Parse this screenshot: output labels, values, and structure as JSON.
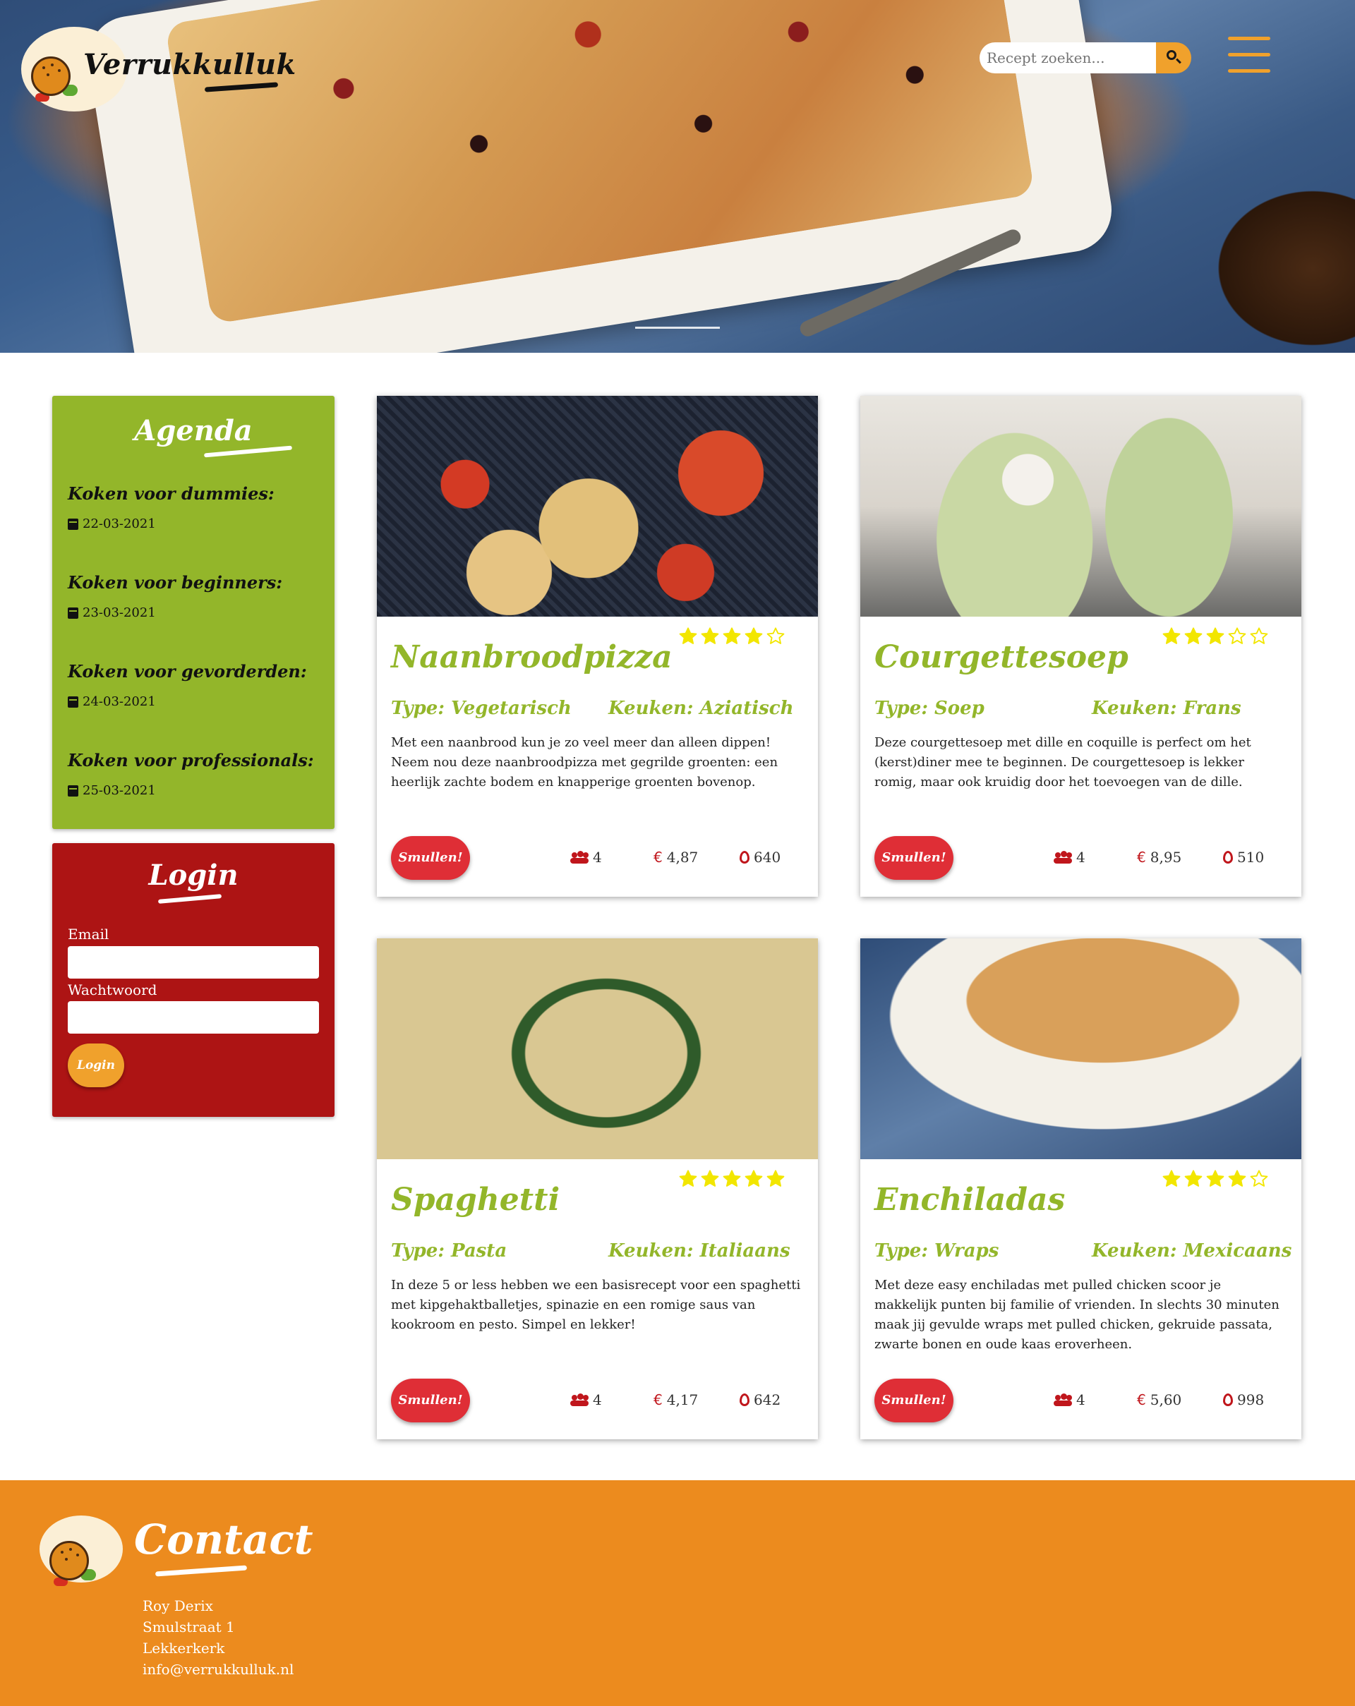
{
  "header": {
    "brand": "Verrukkulluk",
    "search_placeholder": "Recept zoeken..."
  },
  "agenda": {
    "title": "Agenda",
    "events": [
      {
        "name": "Koken voor dummies:",
        "date": "22-03-2021"
      },
      {
        "name": "Koken voor beginners:",
        "date": "23-03-2021"
      },
      {
        "name": "Koken voor gevorderden:",
        "date": "24-03-2021"
      },
      {
        "name": "Koken voor professionals:",
        "date": "25-03-2021"
      }
    ]
  },
  "login": {
    "title": "Login",
    "email_label": "Email",
    "password_label": "Wachtwoord",
    "button_label": "Login"
  },
  "recipes": [
    {
      "title": "Naanbroodpizza",
      "rating": 4,
      "type": "Type: Vegetarisch",
      "cuisine": "Keuken: Aziatisch",
      "description": "Met een naanbrood kun je zo veel meer dan alleen dippen! Neem nou deze naanbroodpizza met gegrilde groenten: een heerlijk zachte bodem en knapperige groenten bovenop.",
      "button": "Smullen!",
      "people": "4",
      "price": "4,87",
      "calories": "640"
    },
    {
      "title": "Courgettesoep",
      "rating": 3,
      "type": "Type: Soep",
      "cuisine": "Keuken: Frans",
      "description": "Deze courgettesoep met dille en coquille is perfect om het (kerst)diner mee te beginnen. De courgettesoep is lekker romig, maar ook kruidig door het toevoegen van de dille.",
      "button": "Smullen!",
      "people": "4",
      "price": "8,95",
      "calories": "510"
    },
    {
      "title": "Spaghetti",
      "rating": 5,
      "type": "Type: Pasta",
      "cuisine": "Keuken: Italiaans",
      "description": "In deze 5 or less hebben we een basisrecept voor een spaghetti met kipgehaktballetjes, spinazie en een romige saus van kookroom en pesto. Simpel en lekker!",
      "button": "Smullen!",
      "people": "4",
      "price": "4,17",
      "calories": "642"
    },
    {
      "title": "Enchiladas",
      "rating": 4,
      "type": "Type: Wraps",
      "cuisine": "Keuken: Mexicaans",
      "description": "Met deze easy enchiladas met pulled chicken scoor je makkelijk punten bij familie of vrienden. In slechts 30 minuten maak jij gevulde wraps met pulled chicken, gekruide passata, zwarte bonen en oude kaas eroverheen.",
      "button": "Smullen!",
      "people": "4",
      "price": "5,60",
      "calories": "998"
    }
  ],
  "currency_symbol": "€",
  "footer": {
    "title": "Contact",
    "lines": [
      "Roy Derix",
      "Smulstraat 1",
      "Lekkerkerk",
      "info@verrukkulluk.nl"
    ]
  },
  "colors": {
    "green": "#93b62a",
    "red": "#ad1414",
    "orange": "#ec8b1e",
    "button_red": "#df2e36",
    "star_yellow": "#f2e600"
  },
  "icons": [
    "search-icon",
    "menu-icon",
    "calendar-icon",
    "people-icon",
    "euro-icon",
    "flame-icon",
    "star-icon",
    "logo-burger-icon"
  ]
}
